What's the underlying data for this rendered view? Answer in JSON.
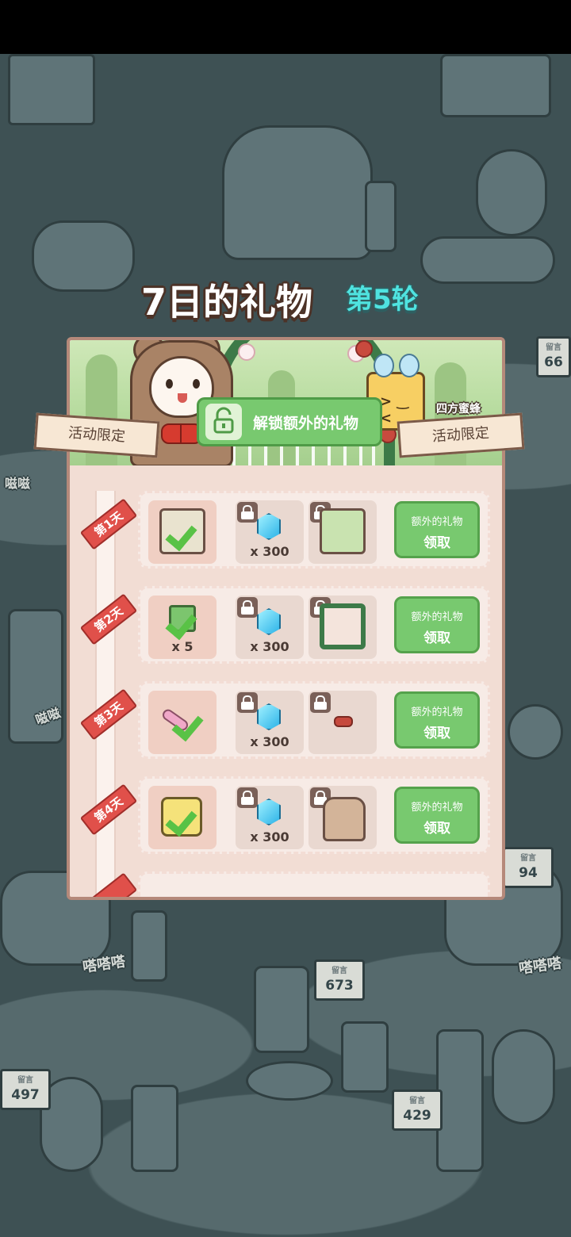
{
  "header": {
    "title": "7日的礼物",
    "round": "第5轮"
  },
  "banner": {
    "unlock_button": "解锁额外的礼物",
    "limited_left": "活动限定",
    "limited_right": "活动限定",
    "bee_name": "四方蜜蜂"
  },
  "days": [
    {
      "tag": "第1天",
      "base_qty": "",
      "gem_qty": "x 300",
      "btn_top": "额外的礼物",
      "btn_main": "领取"
    },
    {
      "tag": "第2天",
      "base_qty": "x 5",
      "gem_qty": "x 300",
      "btn_top": "额外的礼物",
      "btn_main": "领取"
    },
    {
      "tag": "第3天",
      "base_qty": "",
      "gem_qty": "x 300",
      "btn_top": "额外的礼物",
      "btn_main": "领取"
    },
    {
      "tag": "第4天",
      "base_qty": "",
      "gem_qty": "x 300",
      "btn_top": "额外的礼物",
      "btn_main": "领取"
    }
  ],
  "background_labels": {
    "sign_1": "673",
    "sign_2": "497",
    "sign_3": "429",
    "sign_4": "94",
    "sign_5": "66",
    "sound_1": "嗒嗒嗒",
    "sound_2": "嗒嗒嗒",
    "sound_3": "嗞嗞",
    "sound_4": "嗞嗞"
  },
  "colors": {
    "accent_green": "#78c96f",
    "tag_red": "#e0504a",
    "round_cyan": "#4fe3e0",
    "panel_bg": "#f2ddd4"
  },
  "icons": [
    "lock-icon",
    "gem-icon",
    "check-icon",
    "unlock-icon"
  ]
}
